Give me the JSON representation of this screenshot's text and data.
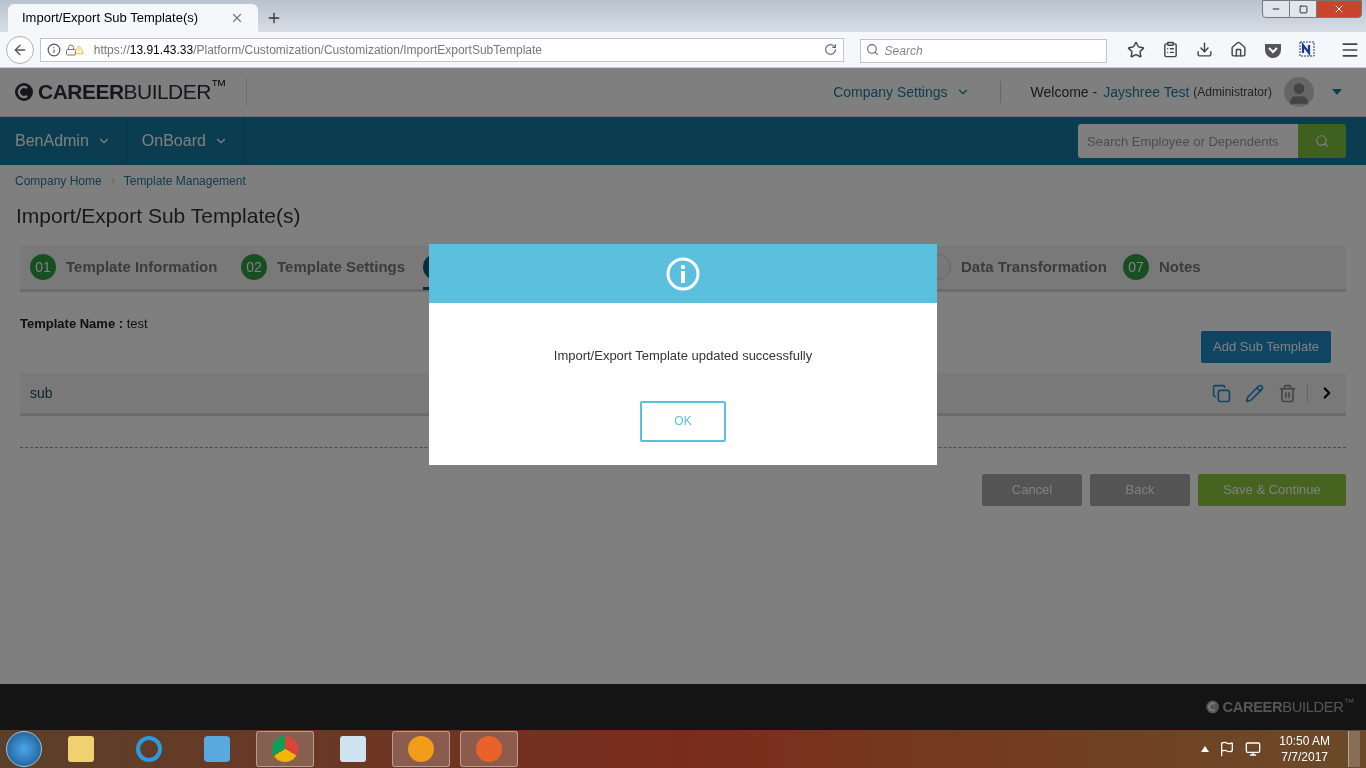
{
  "browser": {
    "tab_title": "Import/Export Sub Template(s)",
    "url_prefix": "https://",
    "url_host": "13.91.43.33",
    "url_path": "/Platform/Customization/Customization/ImportExportSubTemplate",
    "search_placeholder": "Search"
  },
  "header": {
    "logo": "**CAREER**BUILDER$^{™}$",
    "company_settings": "Company Settings",
    "welcome": "Welcome -",
    "user_name": "Jayshree Test",
    "user_role": "(Administrator)"
  },
  "nav": {
    "items": [
      {
        "label": "BenAdmin"
      },
      {
        "label": "OnBoard"
      }
    ],
    "search_placeholder": "Search Employee or Dependents"
  },
  "breadcrumb": [
    "Company Home",
    "Template Management"
  ],
  "page_title": "Import/Export Sub Template(s)",
  "steps": [
    {
      "number": "01",
      "label": "Template Information",
      "selected": false,
      "done": true
    },
    {
      "number": "02",
      "label": "Template Settings",
      "selected": false,
      "done": true
    },
    {
      "selected": true
    },
    {
      "label": "Data Transformation",
      "selected": false,
      "done": false
    },
    {
      "number": "07",
      "label": "Notes",
      "selected": false,
      "done": true
    }
  ],
  "template_name": {
    "label": "Template Name :",
    "value": "test"
  },
  "add_button": "Add Sub Template",
  "sub_templates": [
    {
      "name": "sub"
    }
  ],
  "actions": [
    {
      "label": "Cancel",
      "kind": "secondary"
    },
    {
      "label": "Back",
      "kind": "secondary"
    },
    {
      "label": "Save & Continue",
      "kind": "primary"
    }
  ],
  "footer_logo": "**CAREER**BUILDER$^{™}$",
  "dialog": {
    "message": "Import/Export Template updated successfully",
    "button": "OK"
  },
  "taskbar": {
    "time": "10:50 AM",
    "date": "7/7/2017"
  }
}
